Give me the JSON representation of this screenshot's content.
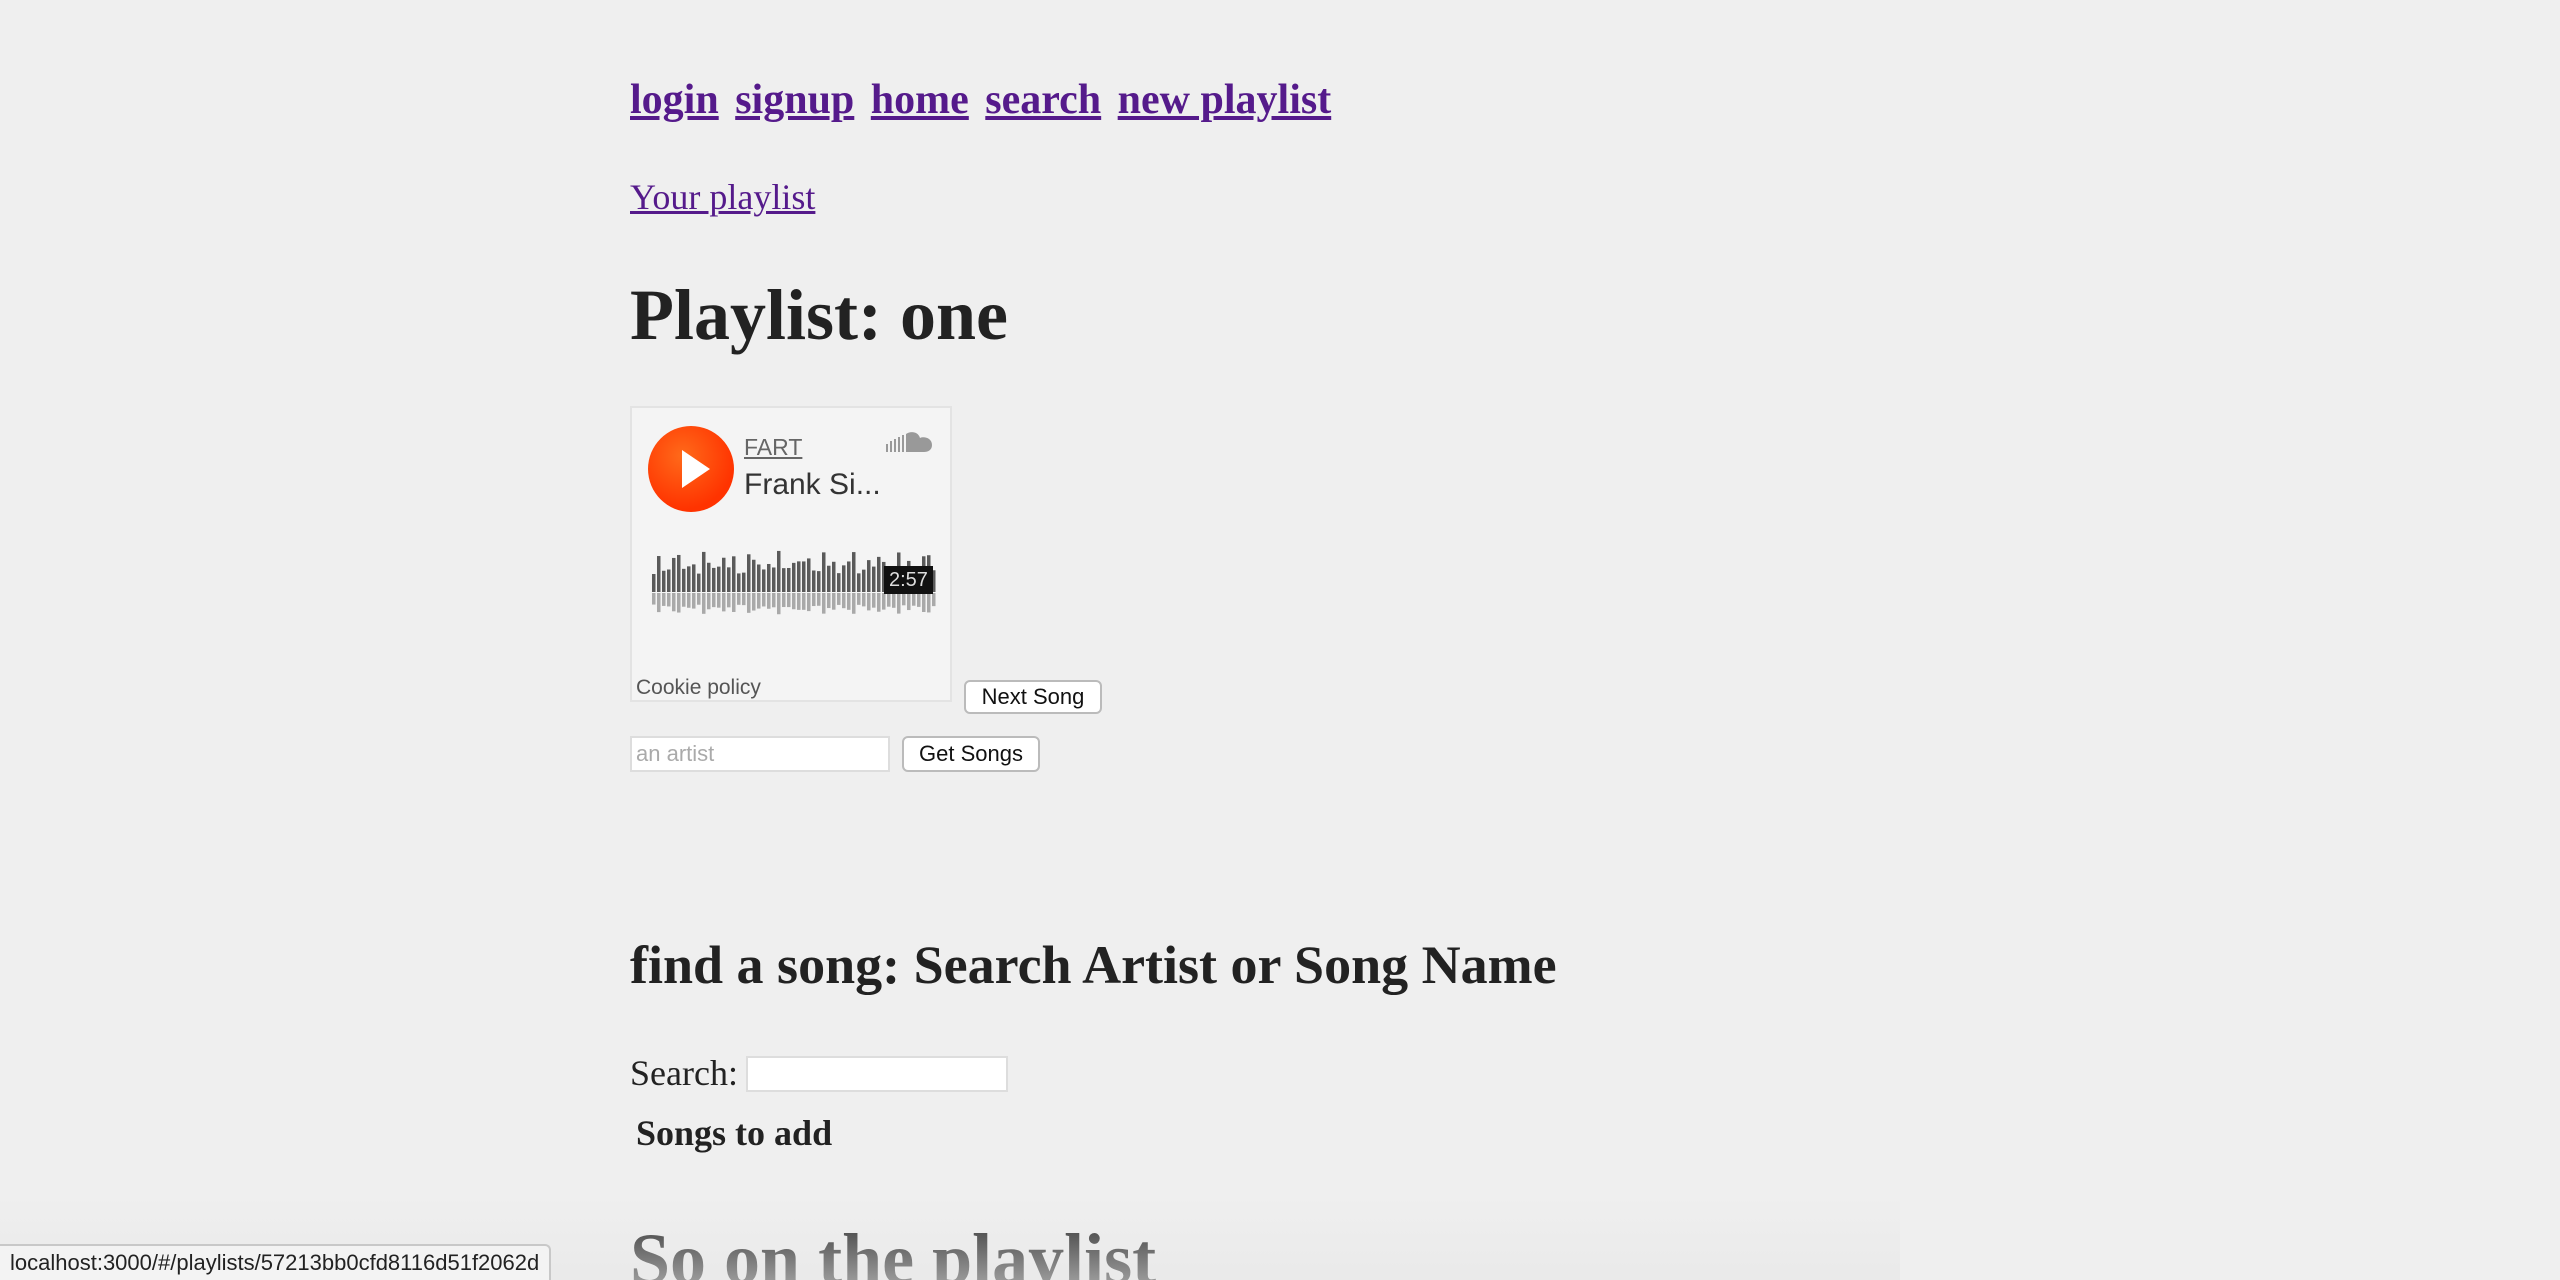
{
  "nav": {
    "links": [
      "login",
      "signup",
      "home",
      "search",
      "new playlist"
    ]
  },
  "your_playlist_link": "Your playlist",
  "playlist_title": "Playlist: one",
  "widget": {
    "user": "FART",
    "track": "Frank Si...",
    "duration": "2:57",
    "cookie": "Cookie policy",
    "logo_icon": "soundcloud-icon",
    "play_icon": "play-icon",
    "accent_color": "#ff3300"
  },
  "next_song_label": "Next Song",
  "artist_input": {
    "placeholder": "an artist",
    "value": ""
  },
  "get_songs_label": "Get Songs",
  "find_title": "find a song: Search Artist or Song Name",
  "search": {
    "label": "Search:",
    "value": ""
  },
  "songs_to_add": "Songs to add",
  "bottom_heading": "So     on the playlist",
  "status_bar": {
    "url": "localhost:3000/#/playlists/57213bb0cfd8116d51f2062d"
  }
}
